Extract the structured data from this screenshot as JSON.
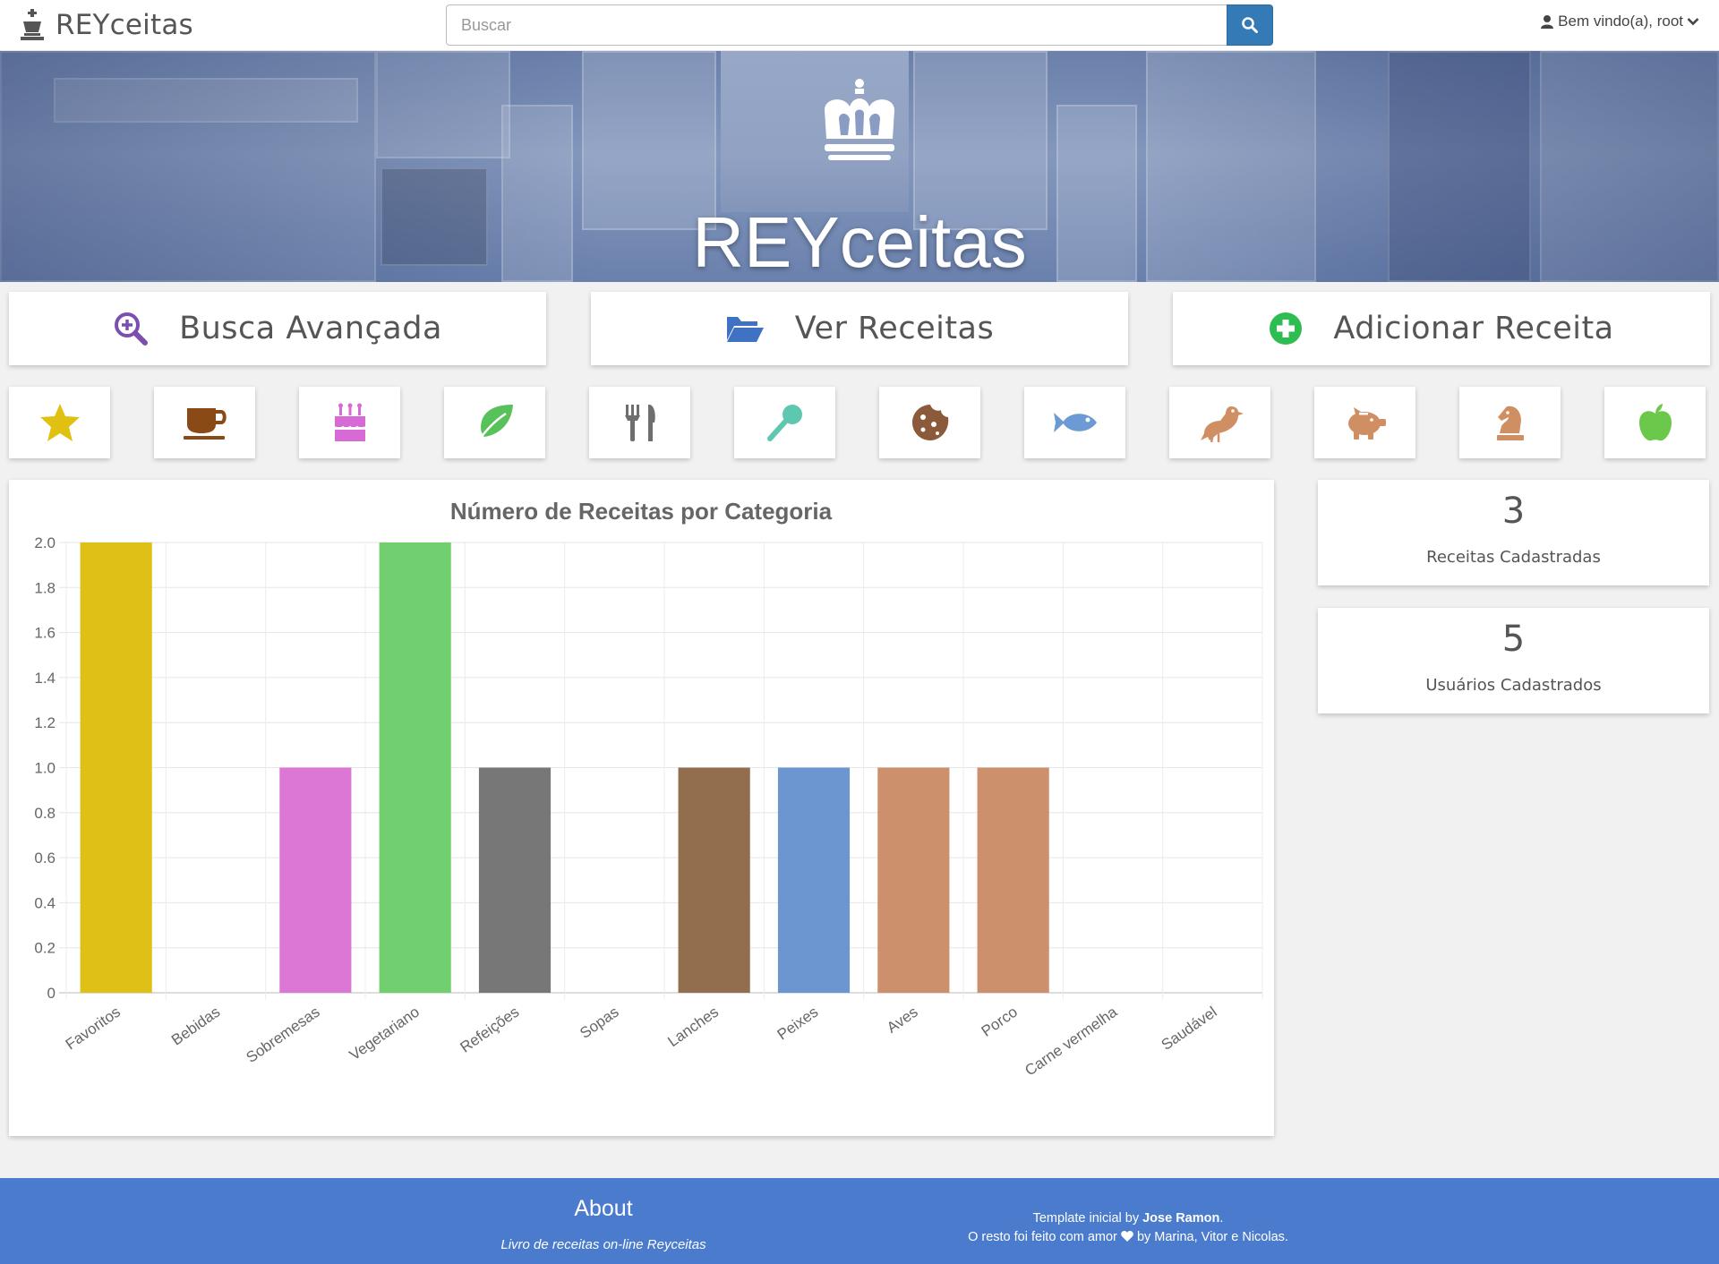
{
  "navbar": {
    "brand": "REYceitas",
    "search_placeholder": "Buscar",
    "user_greeting": "Bem vindo(a), root"
  },
  "hero": {
    "title": "REYceitas"
  },
  "actions": [
    {
      "label": "Busca Avançada",
      "icon": "search-plus-icon",
      "color": "#7b4fb0"
    },
    {
      "label": "Ver Receitas",
      "icon": "folder-open-icon",
      "color": "#3f72c2"
    },
    {
      "label": "Adicionar Receita",
      "icon": "plus-circle-icon",
      "color": "#2ebd50"
    }
  ],
  "categories": [
    {
      "icon": "star-icon",
      "color": "#e0c010"
    },
    {
      "icon": "coffee-icon",
      "color": "#8a4a16"
    },
    {
      "icon": "birthday-cake-icon",
      "color": "#d86ad6"
    },
    {
      "icon": "leaf-icon",
      "color": "#58c25a"
    },
    {
      "icon": "cutlery-icon",
      "color": "#6e6e6e"
    },
    {
      "icon": "spoon-icon",
      "color": "#5ec7b0"
    },
    {
      "icon": "cookie-icon",
      "color": "#8a5a3a"
    },
    {
      "icon": "fish-icon",
      "color": "#6b9ad4"
    },
    {
      "icon": "bird-icon",
      "color": "#cf8f63"
    },
    {
      "icon": "piggy-bank-icon",
      "color": "#cf8f63"
    },
    {
      "icon": "chess-knight-icon",
      "color": "#cf8f63"
    },
    {
      "icon": "apple-icon",
      "color": "#6cc84a"
    }
  ],
  "stats": [
    {
      "value": "3",
      "label": "Receitas Cadastradas"
    },
    {
      "value": "5",
      "label": "Usuários Cadastrados"
    }
  ],
  "chart_data": {
    "type": "bar",
    "title": "Número de Receitas por Categoria",
    "categories": [
      "Favoritos",
      "Bebidas",
      "Sobremesas",
      "Vegetariano",
      "Refeições",
      "Sopas",
      "Lanches",
      "Peixes",
      "Aves",
      "Porco",
      "Carne vermelha",
      "Saudável"
    ],
    "values": [
      2,
      0,
      1,
      2,
      1,
      0,
      1,
      1,
      1,
      1,
      0,
      0
    ],
    "colors": [
      "#dfc016",
      "#8a4a16",
      "#dd77d6",
      "#72cf70",
      "#777777",
      "#5ec7b0",
      "#936e4e",
      "#6c96cf",
      "#cd906c",
      "#cd906c",
      "#cd906c",
      "#6cc84a"
    ],
    "ylim": [
      0,
      2
    ],
    "yticks": [
      "2.0",
      "1.8",
      "1.6",
      "1.4",
      "1.2",
      "1.0",
      "0.8",
      "0.6",
      "0.4",
      "0.2",
      "0"
    ],
    "grid": true,
    "legend": "none"
  },
  "footer": {
    "about_title": "About",
    "about_text": "Livro de receitas on-line Reyceitas",
    "credits_line1_prefix": "Template inicial by ",
    "credits_author": "Jose Ramon",
    "credits_line1_suffix": ".",
    "credits_line2_prefix": "O resto foi feito com amor ",
    "credits_line2_suffix": " by Marina, Vitor e Nicolas."
  }
}
